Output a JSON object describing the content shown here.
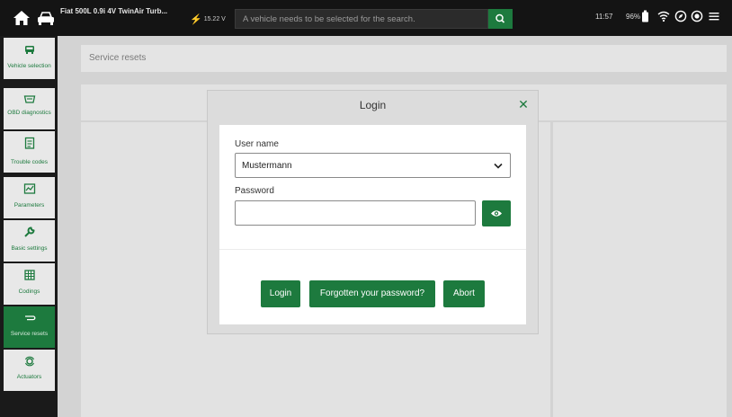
{
  "topbar": {
    "vehicle_name": "Fiat 500L 0.9i 4V TwinAir Turb...",
    "voltage": "15.22 V",
    "search_placeholder": "A vehicle needs to be selected for the search.",
    "time": "11:57",
    "battery": "96%"
  },
  "sidebar": {
    "items": [
      {
        "label": "Vehicle selection",
        "icon": "car-icon"
      },
      {
        "label": "OBD diagnostics",
        "icon": "obd-icon"
      },
      {
        "label": "Trouble codes",
        "icon": "trouble-codes-icon"
      },
      {
        "label": "Parameters",
        "icon": "parameters-icon"
      },
      {
        "label": "Basic settings",
        "icon": "wrench-icon"
      },
      {
        "label": "Codings",
        "icon": "codings-icon"
      },
      {
        "label": "Service resets",
        "icon": "service-reset-icon"
      },
      {
        "label": "Actuators",
        "icon": "actuators-icon"
      }
    ],
    "active_index": 6,
    "expand_arrow": "→"
  },
  "main": {
    "page_title": "Service resets"
  },
  "modal": {
    "title": "Login",
    "close": "✕",
    "username_label": "User name",
    "username_value": "Mustermann",
    "password_label": "Password",
    "password_value": "",
    "buttons": {
      "login": "Login",
      "forgot": "Forgotten your password?",
      "abort": "Abort"
    }
  },
  "colors": {
    "accent": "#1d7a3e",
    "topbar": "#141414",
    "sidebar": "#1a1a1a"
  }
}
